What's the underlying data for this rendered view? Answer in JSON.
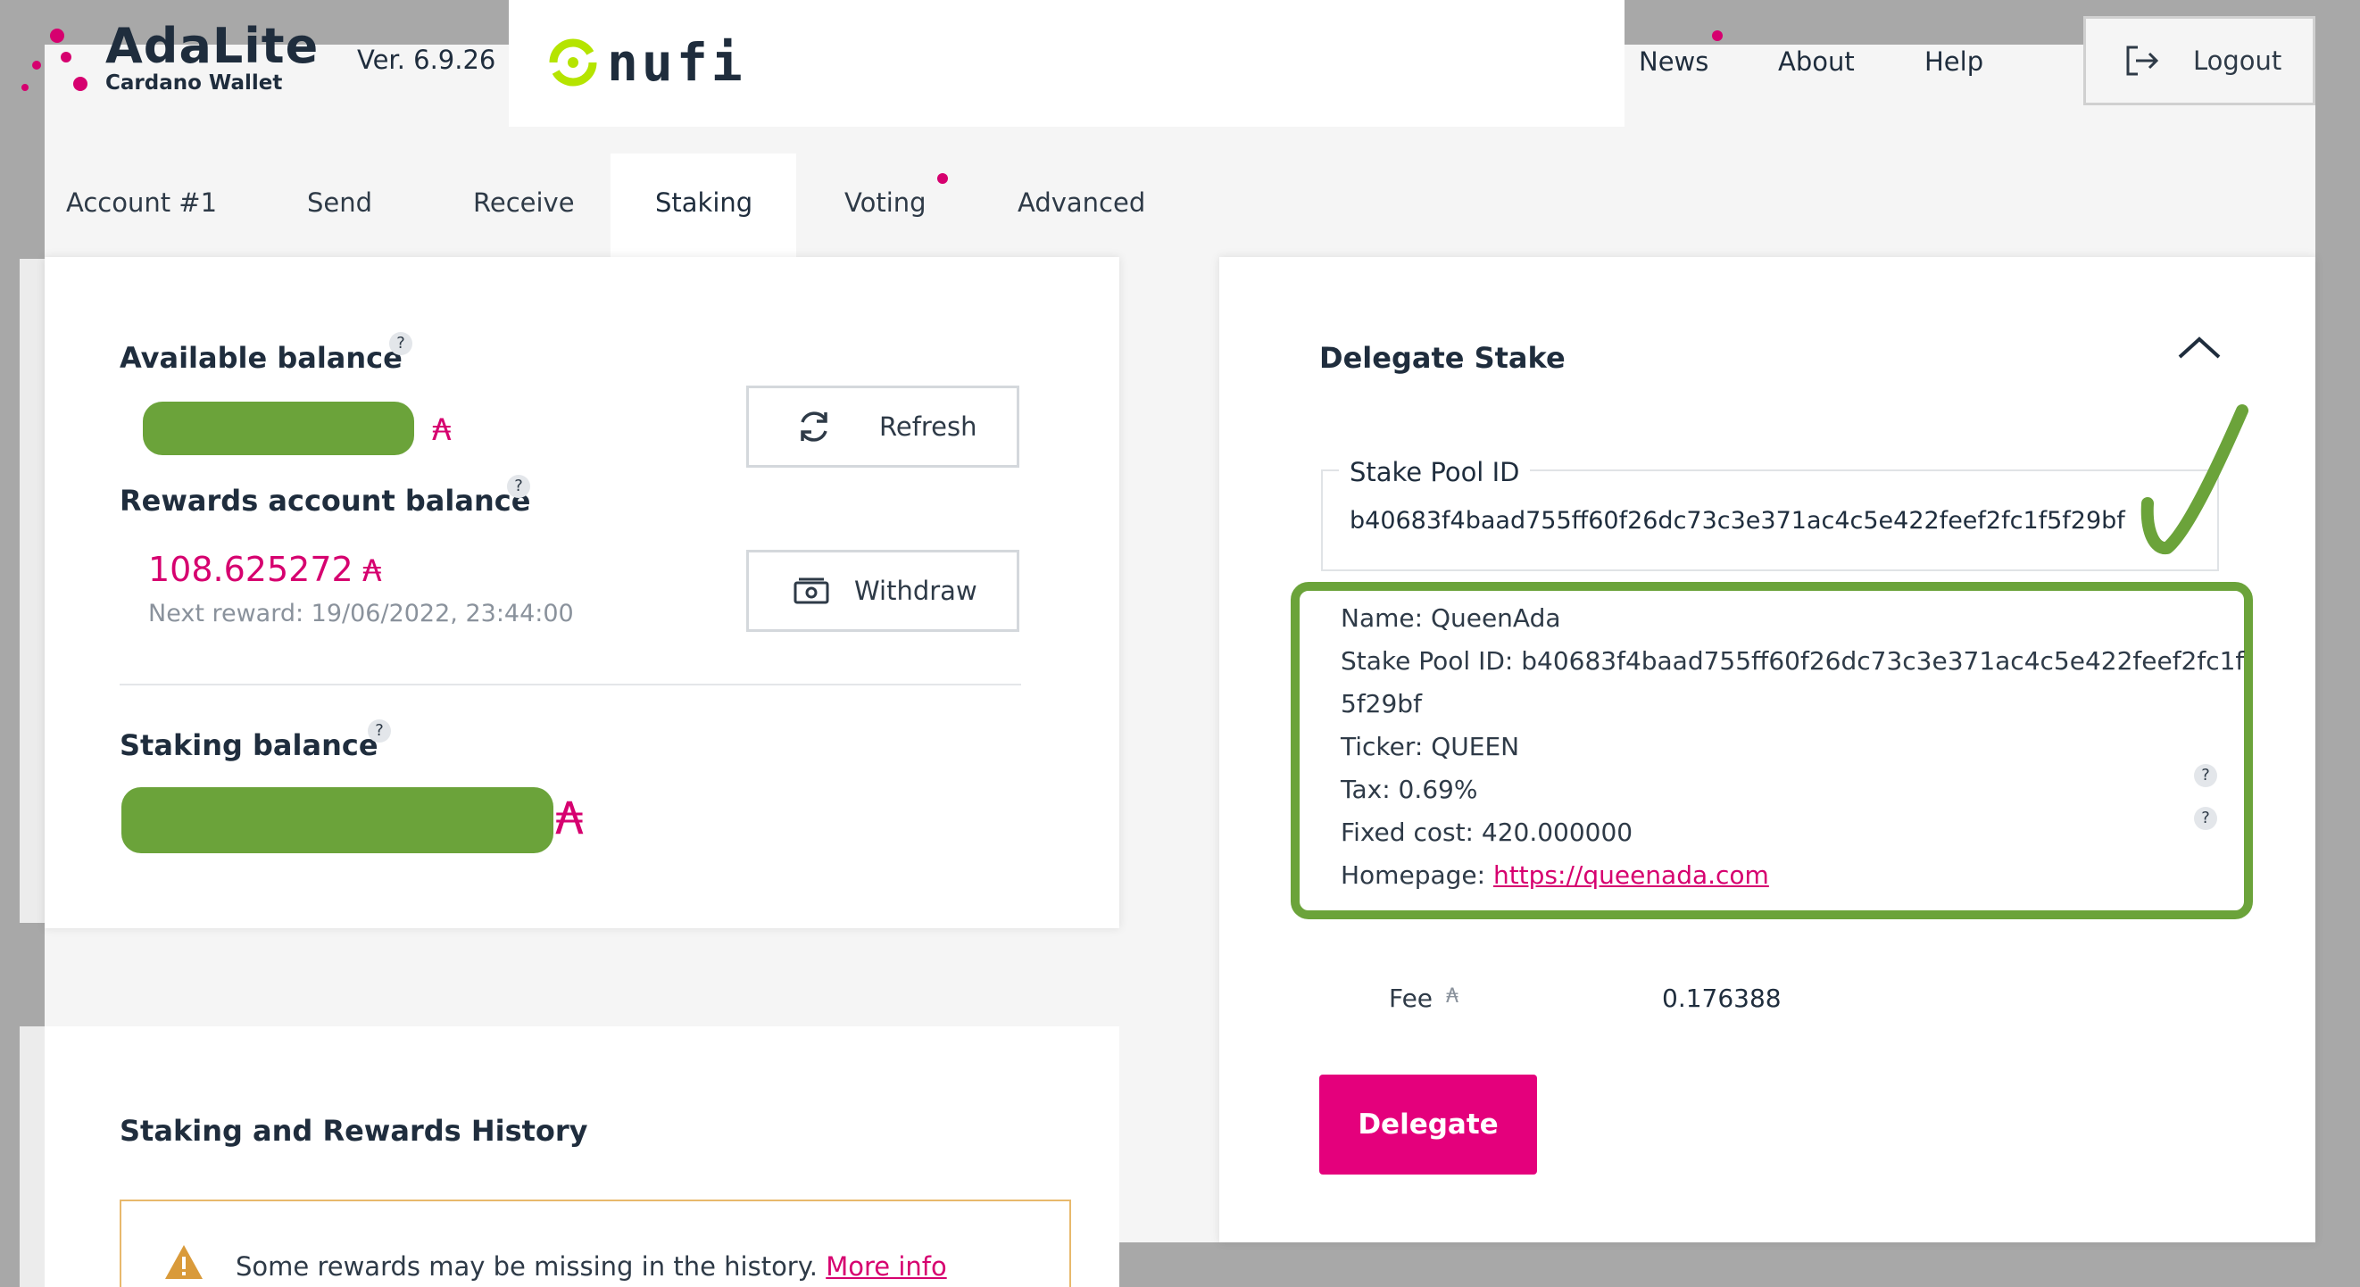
{
  "brand": {
    "title": "AdaLite",
    "subtitle": "Cardano Wallet",
    "version": "Ver. 6.9.26",
    "partner": "nufi"
  },
  "nav": {
    "news": "News",
    "about": "About",
    "help": "Help",
    "logout": "Logout"
  },
  "tabs": [
    "Account #1",
    "Send",
    "Receive",
    "Staking",
    "Voting",
    "Advanced"
  ],
  "balances": {
    "available_label": "Available balance",
    "rewards_label": "Rewards account balance",
    "rewards_value": "108.625272",
    "next_reward": "Next reward: 19/06/2022, 23:44:00",
    "staking_label": "Staking balance",
    "currency_symbol": "₳",
    "refresh_label": "Refresh",
    "withdraw_label": "Withdraw",
    "help_glyph": "?"
  },
  "delegate": {
    "title": "Delegate Stake",
    "field_label": "Stake Pool ID",
    "pool_id": "b40683f4baad755ff60f26dc73c3e371ac4c5e422feef2fc1f5f29bf",
    "pool": {
      "name": "Name: QueenAda",
      "id_line1": "Stake Pool ID: b40683f4baad755ff60f26dc73c3e371ac4c5e422feef2fc1f",
      "id_line2": "5f29bf",
      "ticker": "Ticker: QUEEN",
      "tax": "Tax: 0.69%",
      "fixed_cost": "Fixed cost: 420.000000",
      "homepage_label": "Homepage: ",
      "homepage_url": "https://queenada.com"
    },
    "fee_label": "Fee",
    "fee_value": "0.176388",
    "button": "Delegate"
  },
  "history": {
    "title": "Staking and Rewards History",
    "warning": "Some rewards may be missing in the history. ",
    "more_info": "More info"
  },
  "colors": {
    "accent": "#d6006f",
    "highlight": "#6ba33a",
    "nufi_green": "#b5e400",
    "text": "#1f2d3d"
  }
}
